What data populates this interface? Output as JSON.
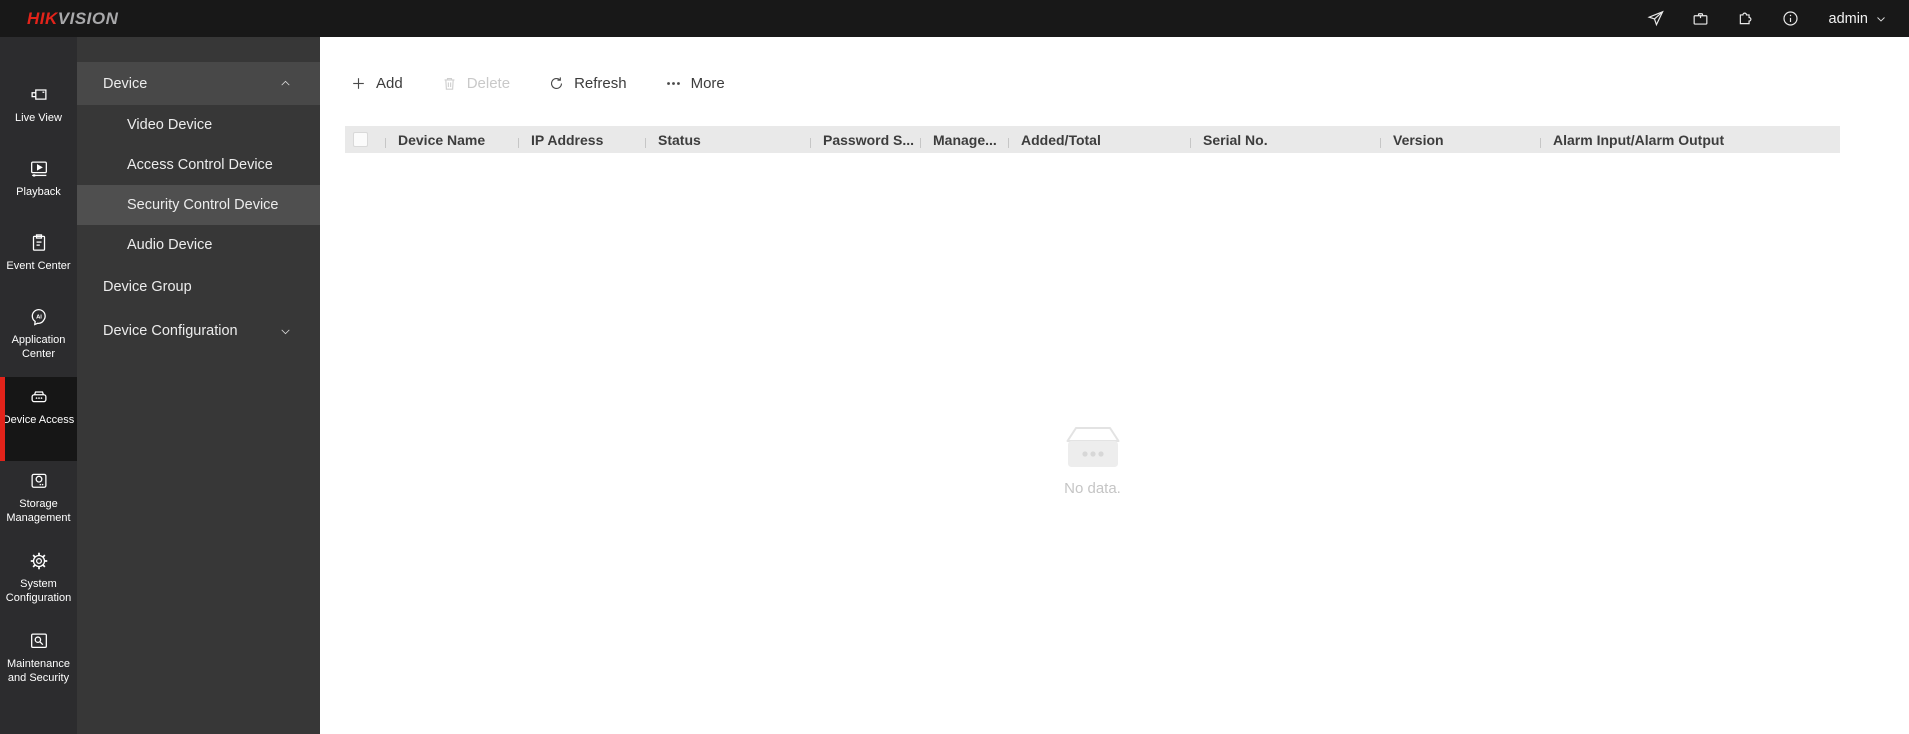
{
  "topbar": {
    "logo_hik": "HIK",
    "logo_vision": "VISION",
    "user_label": "admin",
    "icons": [
      "send-icon",
      "toolbox-icon",
      "plugin-icon",
      "info-icon"
    ]
  },
  "sidebar": {
    "items": [
      {
        "label": "Live View",
        "icon": "live-view-icon",
        "selected": false
      },
      {
        "label": "Playback",
        "icon": "playback-icon",
        "selected": false
      },
      {
        "label": "Event Center",
        "icon": "event-center-icon",
        "selected": false
      },
      {
        "label": "Application Center",
        "icon": "application-center-icon",
        "selected": false
      },
      {
        "label": "Device Access",
        "icon": "device-access-icon",
        "selected": true
      },
      {
        "label": "Storage Management",
        "icon": "storage-management-icon",
        "selected": false
      },
      {
        "label": "System Configuration",
        "icon": "system-configuration-icon",
        "selected": false
      },
      {
        "label": "Maintenance and Security",
        "icon": "maintenance-security-icon",
        "selected": false
      }
    ]
  },
  "submenu": {
    "device_header": "Device",
    "device_expanded": true,
    "items": {
      "video": "Video Device",
      "access_control": "Access Control Device",
      "security_control": "Security Control Device",
      "audio": "Audio Device",
      "device_group": "Device Group",
      "device_configuration": "Device Configuration"
    },
    "selected_item": "Security Control Device"
  },
  "toolbar": {
    "add_label": "Add",
    "delete_label": "Delete",
    "delete_disabled": true,
    "refresh_label": "Refresh",
    "more_label": "More"
  },
  "table": {
    "columns": [
      "Device Name",
      "IP Address",
      "Status",
      "Password S...",
      "Manage...",
      "Added/Total",
      "Serial No.",
      "Version",
      "Alarm Input/Alarm Output"
    ]
  },
  "empty_state": {
    "message": "No data."
  },
  "colors": {
    "accent_red": "#e2231a",
    "topbar_bg": "#181818",
    "sidebar_bg": "#2c2c2e",
    "sidebar_selected_bg": "#161616",
    "submenu_bg": "#373737",
    "submenu_header_bg": "#484848",
    "submenu_selected_bg": "#4f4f4f",
    "table_header_bg": "#e9e9e9"
  }
}
